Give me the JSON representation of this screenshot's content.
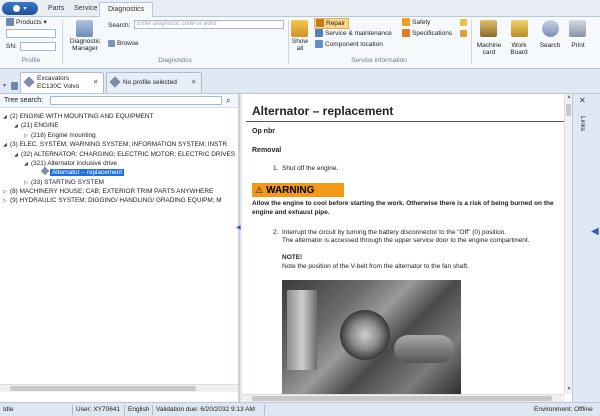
{
  "menu_tabs": [
    "Parts",
    "Service",
    "Diagnostics"
  ],
  "profile": {
    "products_label": "Products",
    "sn_label": "SN:",
    "group_label": "Profile"
  },
  "diagnostics": {
    "search_label": "Search:",
    "search_placeholder": "Enter diagnostic code or word",
    "manager_label": "Diagnostic Manager",
    "browse_label": "Browse",
    "group_label": "Diagnostics"
  },
  "service_info": {
    "show_all": "Show all",
    "repair": "Repair",
    "service_maintenance": "Service & maintenance",
    "component_location": "Component location",
    "safety": "Safety",
    "specifications": "Specifications",
    "group_label": "Service information"
  },
  "ribbon_right": {
    "machine_card": "Machine card",
    "work_board": "Work Board",
    "search": "Search",
    "print": "Print"
  },
  "doc_tabs": [
    {
      "title": "Excavators",
      "subtitle": "EC130C Volvo"
    },
    {
      "title": "No profile selected",
      "subtitle": ""
    }
  ],
  "tree_search_label": "Tree search:",
  "tree": [
    {
      "text": "(2) ENGINE WITH MOUNTING AND EQUIPMENT",
      "marker": "◢"
    },
    {
      "text": "(21) ENGINE",
      "marker": "◢"
    },
    {
      "text": "(218) Engine mounting",
      "marker": "▷"
    },
    {
      "text": "(3) ELEC. SYSTEM; WARNING SYSTEM; INFORMATION  SYSTEM; INSTR",
      "marker": "◢"
    },
    {
      "text": "(32) ALTERNATOR; CHARGING; ELECTRIC MOTOR; ELECTRIC DRIVES",
      "marker": "◢"
    },
    {
      "text": "(321) Alternator inclusive drive",
      "marker": "◢"
    },
    {
      "text": "Alternator – replacement",
      "marker": ""
    },
    {
      "text": "(33) STARTING SYSTEM",
      "marker": "▷"
    },
    {
      "text": "(8) MACHINERY HOUSE; CAB; EXTERIOR TRIM PARTS  ANYWHERE",
      "marker": "▷"
    },
    {
      "text": "(9) HYDRAULIC SYSTEM; DIGGING/ HANDLING/  GRADING EQUIPM; M",
      "marker": "▷"
    }
  ],
  "document": {
    "title": "Alternator – replacement",
    "op_nbr": "Op nbr",
    "section": "Removal",
    "step1": "Shut off the engine.",
    "warning_label": "WARNING",
    "warning_text": "Allow the engine to cool before starting the work. Otherwise there is a risk of being burned on the engine and exhaust pipe.",
    "step2": "Interrupt the circuit by turning the battery disconnector to the \"Off\" (0) position.",
    "step2_detail": "The alternator is accessed through the upper service door to the engine compartment.",
    "note_label": "NOTE!",
    "note_text": "Note the position of the V-belt from the alternator to the fan shaft."
  },
  "side_panel_label": "Links",
  "status": {
    "state": "Idle",
    "user": "User: XY70641",
    "language": "English",
    "validation": "Validation due: 6/20/2032 9:13 AM",
    "environment": "Environment: Offline"
  },
  "colors": {
    "accent": "#2b5fae",
    "warning_bg": "#f29a18",
    "selection": "#1f6fe0"
  }
}
